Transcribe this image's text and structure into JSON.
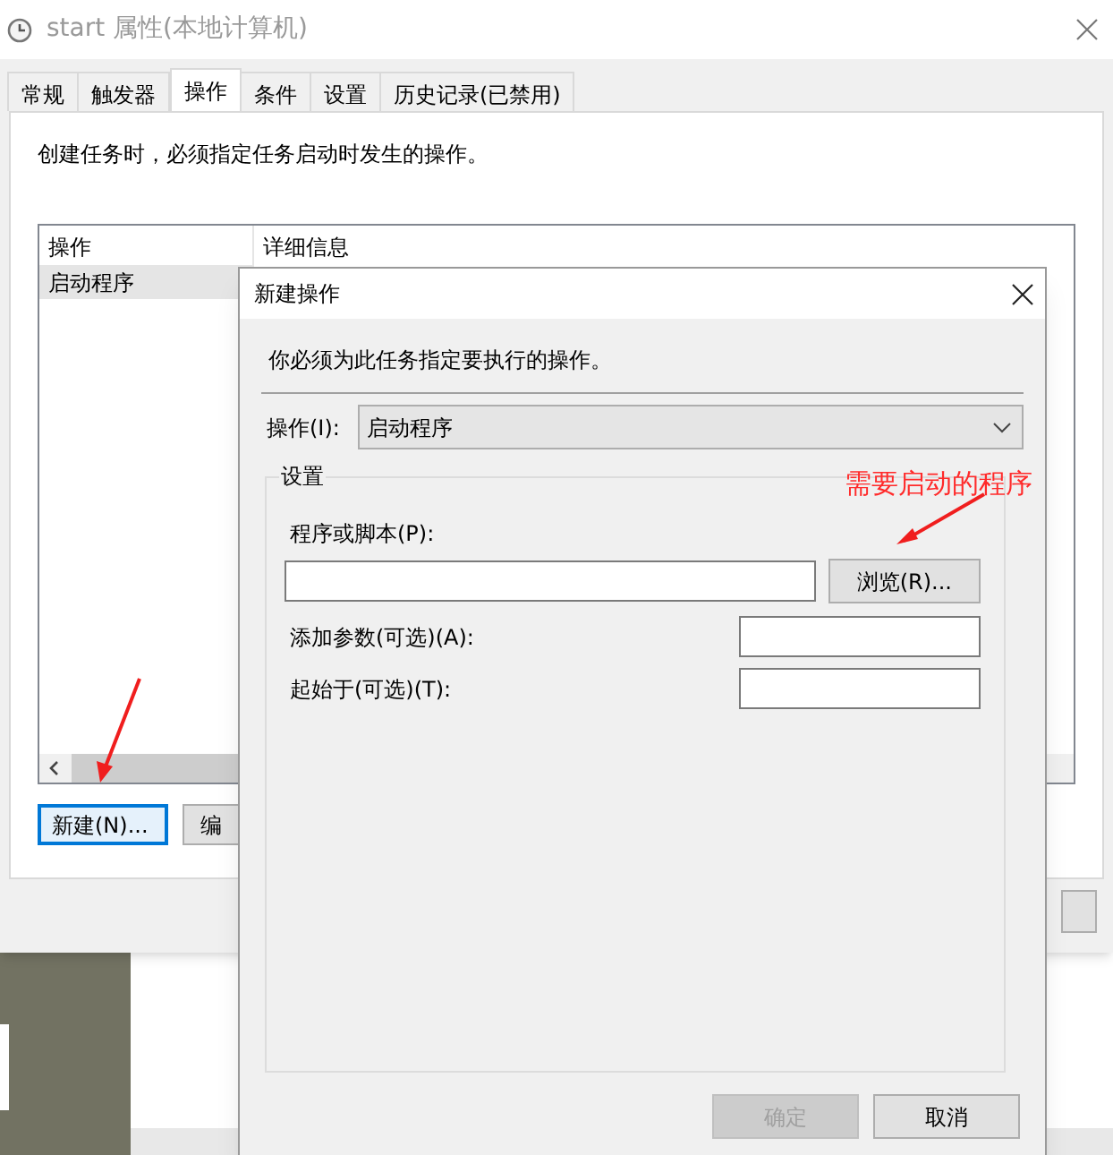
{
  "window": {
    "title": "start 属性(本地计算机)"
  },
  "tabs": [
    {
      "label": "常规",
      "selected": false
    },
    {
      "label": "触发器",
      "selected": false
    },
    {
      "label": "操作",
      "selected": true
    },
    {
      "label": "条件",
      "selected": false
    },
    {
      "label": "设置",
      "selected": false
    },
    {
      "label": "历史记录(已禁用)",
      "selected": false
    }
  ],
  "actions_tab": {
    "description": "创建任务时，必须指定任务启动时发生的操作。",
    "table": {
      "columns": [
        "操作",
        "详细信息"
      ],
      "rows": [
        {
          "cells": [
            "启动程序"
          ],
          "selected": true
        }
      ]
    },
    "buttons": [
      {
        "label": "新建(N)...",
        "focused": true
      },
      {
        "label": "编",
        "focused": false
      }
    ]
  },
  "dialog": {
    "title": "新建操作",
    "description": "你必须为此任务指定要执行的操作。",
    "action": {
      "label": "操作(I):",
      "value": "启动程序"
    },
    "settings": {
      "title": "设置",
      "program": {
        "label": "程序或脚本(P):"
      },
      "browse_button": "浏览(R)...",
      "arguments": {
        "label": "添加参数(可选)(A):"
      },
      "start_in": {
        "label": "起始于(可选)(T):"
      }
    },
    "buttons": [
      {
        "label": "确定",
        "disabled": true
      },
      {
        "label": "取消",
        "disabled": false
      }
    ]
  },
  "annotations": [
    {
      "text": "需要启动的程序"
    }
  ]
}
